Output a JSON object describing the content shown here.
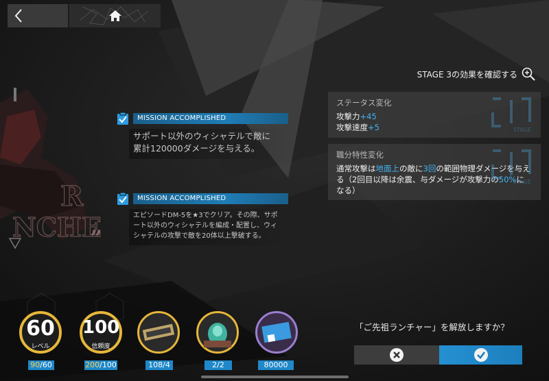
{
  "nav": {
    "back_icon": "chevron-left-icon",
    "home_icon": "home-icon"
  },
  "stage_link": {
    "label": "STAGE 3の効果を確認する",
    "icon": "zoom-in-icon"
  },
  "missions": [
    {
      "status": "MISSION ACCOMPLISHED",
      "lines": [
        "サポート以外のウィシャテルで敵に",
        "累計120000ダメージを与える。"
      ]
    },
    {
      "status": "MISSION ACCOMPLISHED",
      "lines": [
        "エピソードDM-5を★3でクリア。その際、サポ",
        "ート以外のウィシャテルを編成・配置し、ウィ",
        "シャテルの攻撃で敵を20体以上撃破する。"
      ]
    }
  ],
  "status_panel": {
    "title": "ステータス変化",
    "atk_label": "攻撃力",
    "atk_value": "+45",
    "spd_label": "攻撃速度",
    "spd_value": "+5",
    "watermark": "STAGE"
  },
  "trait_panel": {
    "title": "職分特性変化",
    "l1a": "通常攻撃は",
    "l1b": "地面上",
    "l1c": "の敵に",
    "l1d": "3回",
    "l1e": "の範囲物理ダメージを与え",
    "l2a": "る（2回目以降は余震、与ダメージが攻撃力の",
    "l2b": "50%",
    "l2c": "に",
    "l3": "なる）",
    "watermark": "STAGE"
  },
  "items": [
    {
      "big": "60",
      "sub": "レベル",
      "count_a": "90",
      "count_b": "/60"
    },
    {
      "big": "100",
      "sub": "信頼度",
      "count_a": "200",
      "count_b": "/100"
    },
    {
      "count_a": "108",
      "count_b": "/4"
    },
    {
      "count_a": "2",
      "count_b": "/2"
    },
    {
      "count_a": "80000",
      "count_b": ""
    }
  ],
  "confirm": {
    "question": "「ご先祖ランチャー」を解放しますか？",
    "cancel_icon": "close-icon",
    "ok_icon": "check-icon"
  },
  "bg_text": {
    "a": "R",
    "b": "NCHE",
    "c": "„"
  },
  "colors": {
    "accent": "#1f88c9",
    "highlight": "#43b2ef",
    "gold": "#e6b73a"
  }
}
